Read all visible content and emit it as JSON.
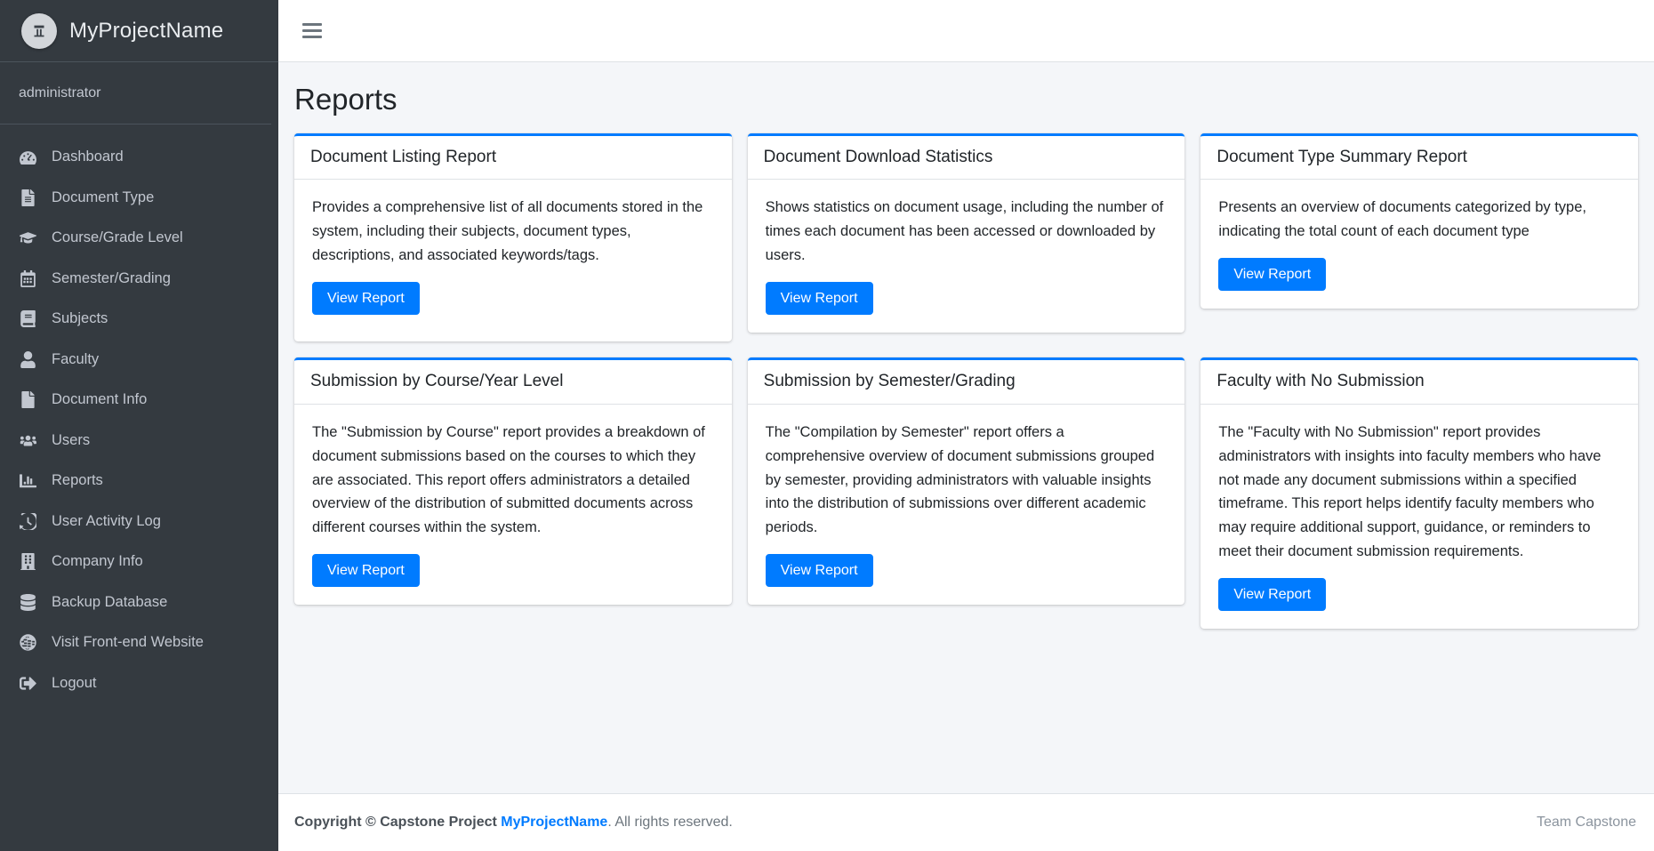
{
  "brand": {
    "title": "MyProjectName",
    "logo_icon": "app-logo-icon"
  },
  "sidebar": {
    "user": "administrator",
    "items": [
      {
        "label": "Dashboard",
        "icon": "tachometer-icon"
      },
      {
        "label": "Document Type",
        "icon": "file-lines-icon"
      },
      {
        "label": "Course/Grade Level",
        "icon": "graduation-cap-icon"
      },
      {
        "label": "Semester/Grading",
        "icon": "calendar-icon"
      },
      {
        "label": "Subjects",
        "icon": "book-icon"
      },
      {
        "label": "Faculty",
        "icon": "user-icon"
      },
      {
        "label": "Document Info",
        "icon": "file-icon"
      },
      {
        "label": "Users",
        "icon": "users-icon"
      },
      {
        "label": "Reports",
        "icon": "chart-bar-icon"
      },
      {
        "label": "User Activity Log",
        "icon": "history-icon"
      },
      {
        "label": "Company Info",
        "icon": "building-icon"
      },
      {
        "label": "Backup Database",
        "icon": "database-icon"
      },
      {
        "label": "Visit Front-end Website",
        "icon": "globe-icon"
      },
      {
        "label": "Logout",
        "icon": "sign-out-icon"
      }
    ]
  },
  "topbar": {
    "menu_toggle_icon": "hamburger-icon"
  },
  "main": {
    "page_title": "Reports",
    "cards": [
      {
        "title": "Document Listing Report",
        "text": "Provides a comprehensive list of all documents stored in the system, including their subjects, document types, descriptions, and associated keywords/tags.",
        "button": "View Report"
      },
      {
        "title": "Document Download Statistics",
        "text": "Shows statistics on document usage, including the number of times each document has been accessed or downloaded by users.",
        "button": "View Report"
      },
      {
        "title": "Document Type Summary Report",
        "text": "Presents an overview of documents categorized by type, indicating the total count of each document type",
        "button": "View Report"
      },
      {
        "title": "Submission by Course/Year Level",
        "text": "The \"Submission by Course\" report provides a breakdown of document submissions based on the courses to which they are associated. This report offers administrators a detailed overview of the distribution of submitted documents across different courses within the system.",
        "button": "View Report"
      },
      {
        "title": "Submission by Semester/Grading",
        "text": "The \"Compilation by Semester\" report offers a comprehensive overview of document submissions grouped by semester, providing administrators with valuable insights into the distribution of submissions over different academic periods.",
        "button": "View Report"
      },
      {
        "title": "Faculty with No Submission",
        "text": "The \"Faculty with No Submission\" report provides administrators with insights into faculty members who have not made any document submissions within a specified timeframe. This report helps identify faculty members who may require additional support, guidance, or reminders to meet their document submission requirements.",
        "button": "View Report"
      }
    ]
  },
  "footer": {
    "copyright_prefix": "Copyright © Capstone Project ",
    "project_link": "MyProjectName",
    "copyright_suffix": ". All rights reserved.",
    "right": "Team Capstone"
  },
  "colors": {
    "accent": "#007bff",
    "sidebar_bg": "#343a40",
    "content_bg": "#f4f6f9"
  }
}
